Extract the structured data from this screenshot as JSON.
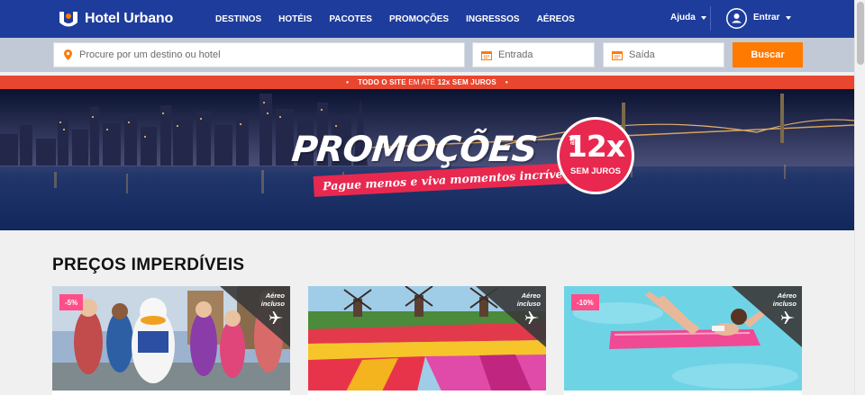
{
  "header": {
    "logo_text": "Hotel Urbano",
    "nav": [
      "DESTINOS",
      "HOTÉIS",
      "PACOTES",
      "PROMOÇÕES",
      "INGRESSOS",
      "AÉREOS"
    ],
    "help_label": "Ajuda",
    "login_label": "Entrar"
  },
  "search": {
    "destination_placeholder": "Procure por um destino ou hotel",
    "checkin_placeholder": "Entrada",
    "checkout_placeholder": "Saída",
    "button_label": "Buscar"
  },
  "banner": {
    "strip_part1": "TODO O SITE",
    "strip_part2": " EM ATÉ ",
    "strip_part3": "12x SEM JUROS",
    "title": "PROMOÇÕES",
    "subtitle": "Pague menos e viva momentos incríveis.",
    "badge_ate": "até",
    "badge_12x": "12x",
    "badge_sem_juros": "SEM JUROS"
  },
  "section": {
    "title": "PREÇOS IMPERDÍVEIS"
  },
  "cards": [
    {
      "discount": "-5%",
      "tag_line1": "Aéreo",
      "tag_line2": "incluso"
    },
    {
      "discount": "",
      "tag_line1": "Aéreo",
      "tag_line2": "incluso"
    },
    {
      "discount": "-10%",
      "tag_line1": "Aéreo",
      "tag_line2": "incluso"
    }
  ],
  "colors": {
    "nav_bg": "#1e3c9c",
    "search_button": "#ff7a00",
    "promo_red": "#e8462f",
    "discount_pink": "#ff4f8a"
  }
}
